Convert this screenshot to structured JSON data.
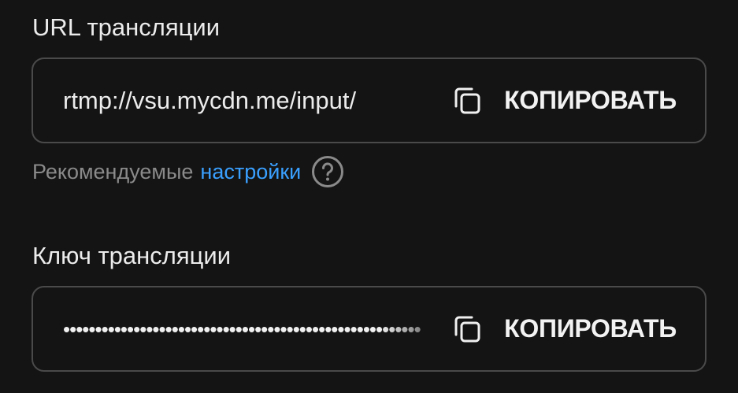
{
  "url_section": {
    "label": "URL трансляции",
    "value": "rtmp://vsu.mycdn.me/input/",
    "copy_label": "КОПИРОВАТЬ"
  },
  "hint": {
    "text": "Рекомендуемые",
    "link": "настройки",
    "help_icon": "question-circle-icon"
  },
  "key_section": {
    "label": "Ключ трансляции",
    "masked_value": "••••••••••••••••••••••••••••••••••••••••••••••••••••••••",
    "copy_label": "КОПИРОВАТЬ"
  },
  "colors": {
    "background": "#141414",
    "border": "#4a4a4a",
    "text": "#ececec",
    "muted": "#8a8a8a",
    "link": "#3aa0ff"
  },
  "icons": {
    "copy": "copy-icon"
  }
}
